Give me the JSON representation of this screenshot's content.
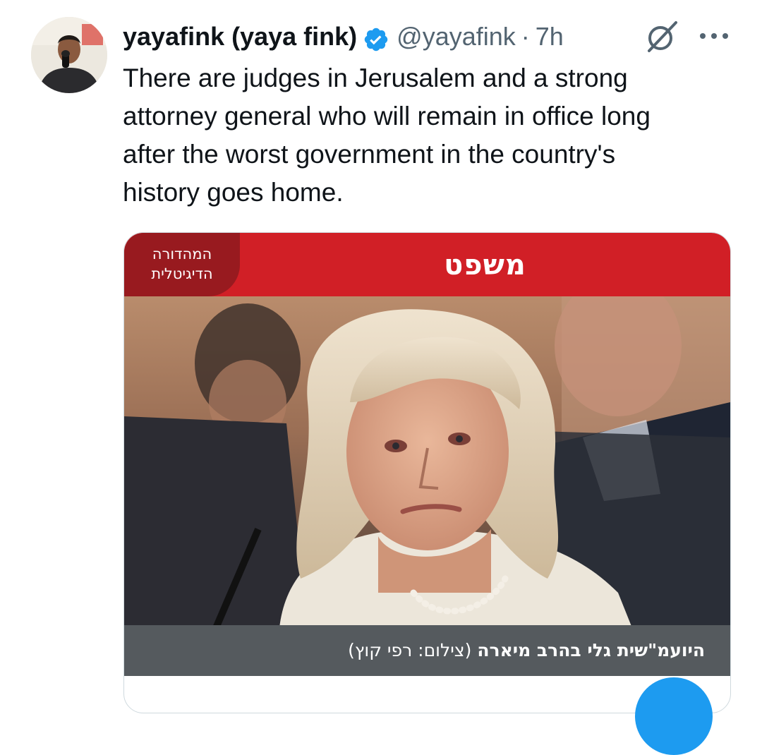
{
  "tweet": {
    "display_name": "yayafink (yaya fink)",
    "verified_icon": "verified-badge-icon",
    "handle": "@yayafink",
    "separator": "·",
    "time": "7h",
    "text": "There are judges in Jerusalem and a strong\nattorney general who will remain in office long\nafter the worst government in the country's\nhistory goes home."
  },
  "icons": {
    "grok": "grok-slash-icon",
    "more": "more-dots-icon"
  },
  "media": {
    "edition_badge": "המהדורה\nהדיגיטלית",
    "section_title": "משפט",
    "caption_name": "היועמ\"שית גלי בהרב מיארה",
    "caption_credit": "(צילום: רפי קוץ)"
  },
  "colors": {
    "accent_blue": "#1d9bf0",
    "banner_red": "#d11f26",
    "badge_dark_red": "#981a1f",
    "caption_gray": "#555a5e",
    "muted_text": "#536471"
  }
}
